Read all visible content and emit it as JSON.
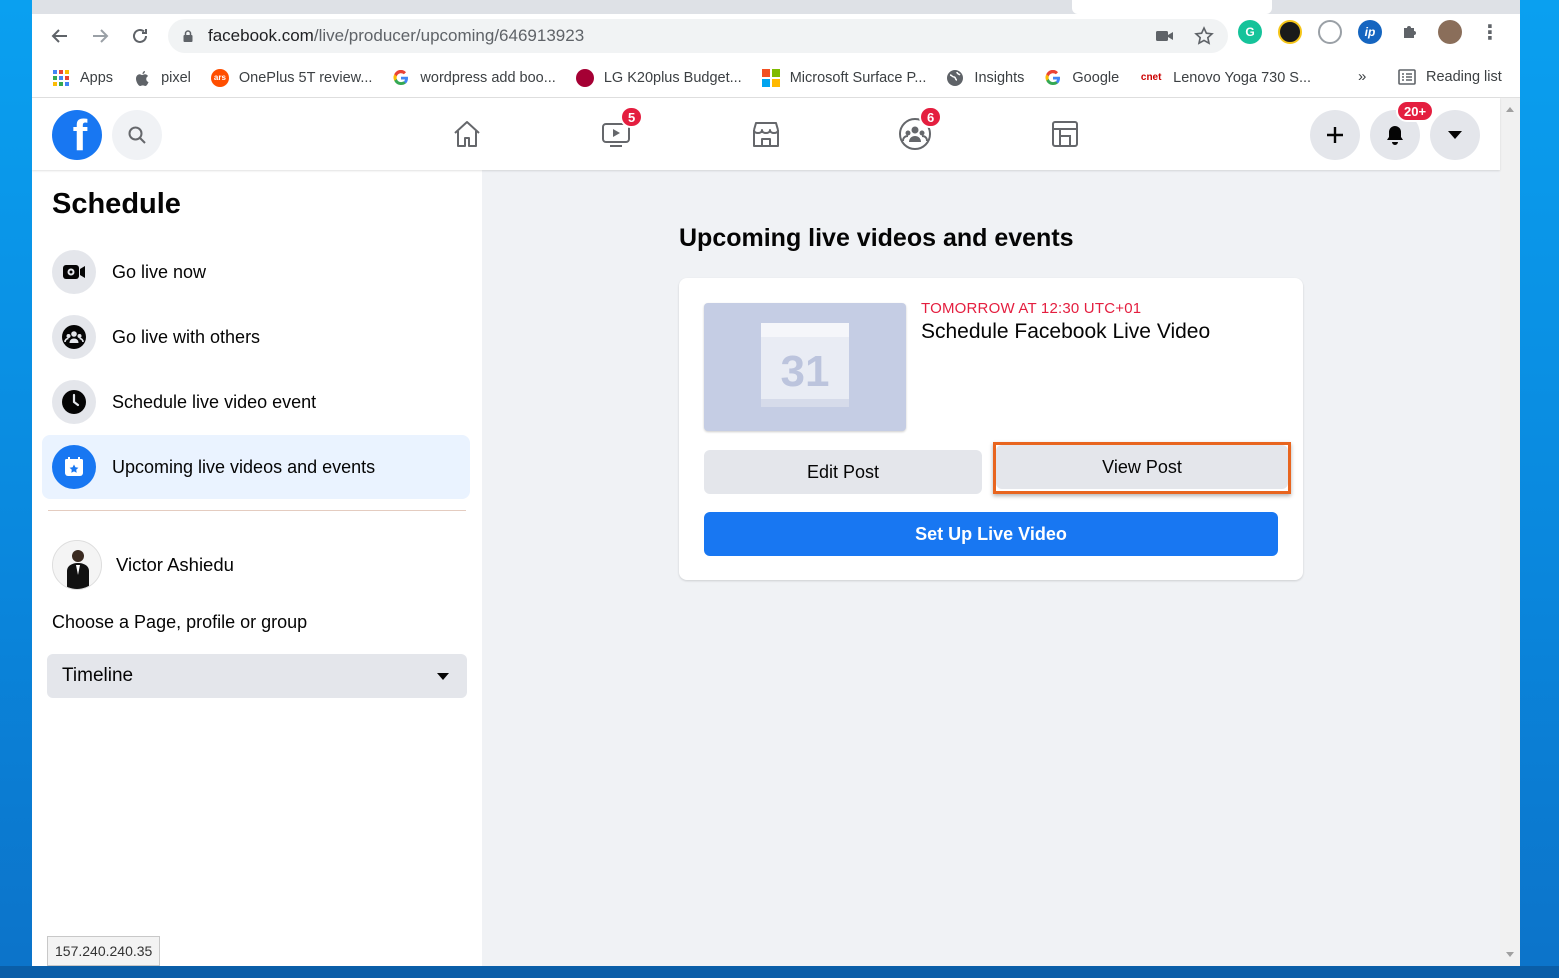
{
  "browser": {
    "url_domain": "facebook.com",
    "url_path": "/live/producer/upcoming/646913923",
    "bookmarks": [
      {
        "label": "Apps",
        "icon": "apps-grid-icon"
      },
      {
        "label": "pixel",
        "icon": "apple-icon"
      },
      {
        "label": "OnePlus 5T review...",
        "icon": "ars-icon"
      },
      {
        "label": "wordpress add boo...",
        "icon": "google-icon"
      },
      {
        "label": "LG K20plus Budget...",
        "icon": "lg-icon"
      },
      {
        "label": "Microsoft Surface P...",
        "icon": "microsoft-icon"
      },
      {
        "label": "Insights",
        "icon": "globe-icon"
      },
      {
        "label": "Google",
        "icon": "google-icon"
      },
      {
        "label": "Lenovo Yoga 730 S...",
        "icon": "cnet-icon"
      }
    ],
    "more_label": "»",
    "reading_list_label": "Reading list",
    "ars_text": "ars",
    "cnet_text": "cnet"
  },
  "fb_nav": {
    "logo_letter": "f",
    "watch_badge": "5",
    "groups_badge": "6",
    "notifications_badge": "20+"
  },
  "sidebar": {
    "title": "Schedule",
    "items": [
      {
        "label": "Go live now",
        "icon": "video-camera-icon"
      },
      {
        "label": "Go live with others",
        "icon": "group-icon"
      },
      {
        "label": "Schedule live video event",
        "icon": "clock-icon"
      },
      {
        "label": "Upcoming live videos and events",
        "icon": "calendar-star-icon",
        "active": true
      }
    ],
    "profile_name": "Victor Ashiedu",
    "choose_label": "Choose a Page, profile or group",
    "select_value": "Timeline"
  },
  "main": {
    "title": "Upcoming live videos and events",
    "event": {
      "date": "TOMORROW AT 12:30 UTC+01",
      "title": "Schedule Facebook Live Video",
      "calendar_number": "31"
    },
    "edit_label": "Edit Post",
    "view_label": "View Post",
    "setup_label": "Set Up Live Video"
  },
  "status_tip": "157.240.240.35",
  "colors": {
    "fb_blue": "#1877f2",
    "badge_red": "#e41e3f",
    "highlight_orange": "#e8651f"
  }
}
